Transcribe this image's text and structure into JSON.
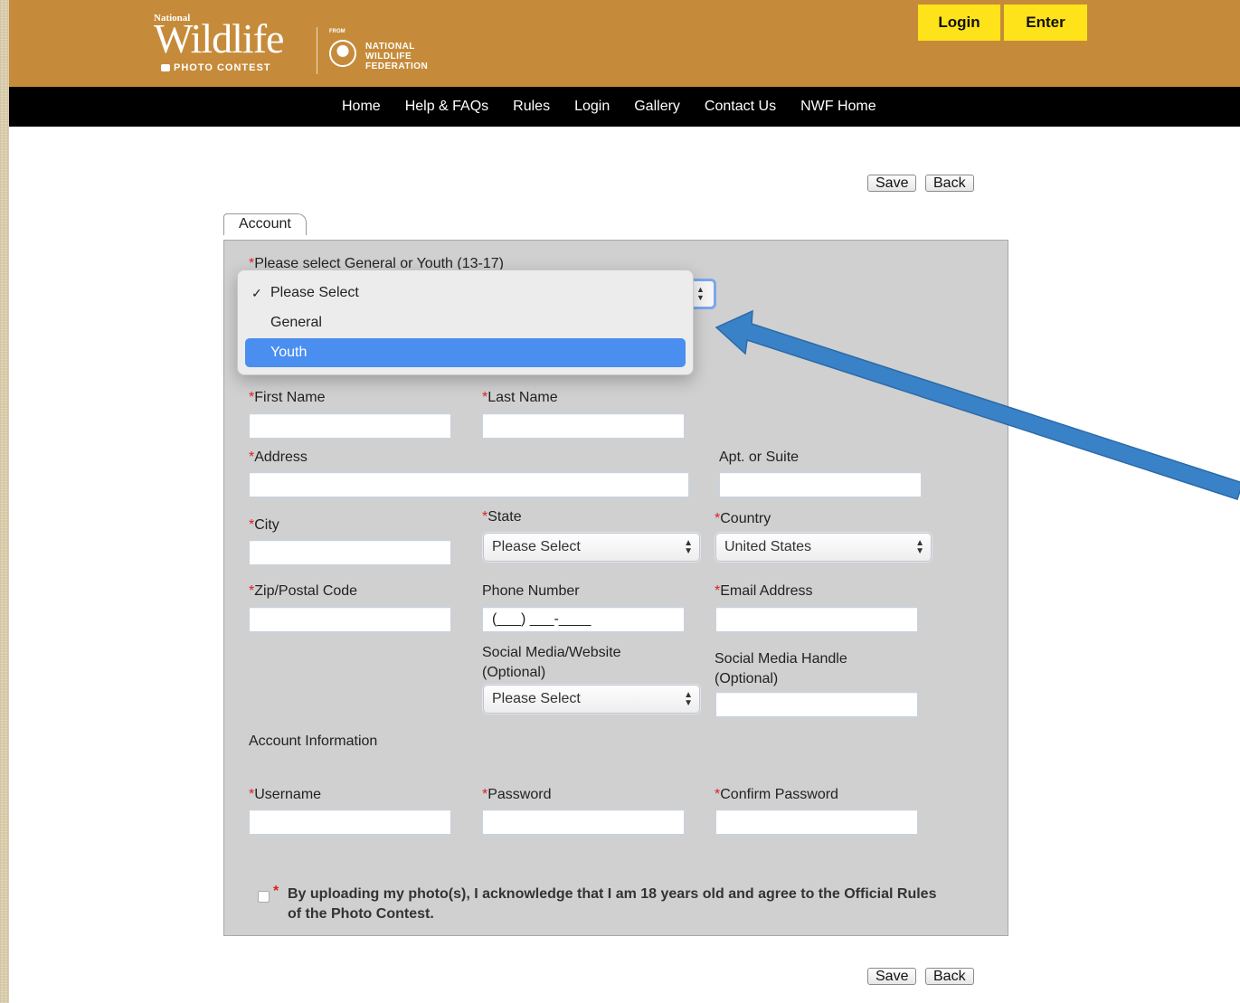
{
  "header": {
    "logo": {
      "national": "National",
      "wildlife": "Wildlife",
      "photo_contest": "PHOTO CONTEST",
      "from": "FROM",
      "nwf_line1": "NATIONAL",
      "nwf_line2": "WILDLIFE",
      "nwf_line3": "FEDERATION"
    },
    "login_label": "Login",
    "enter_label": "Enter"
  },
  "nav": {
    "items": [
      {
        "label": "Home"
      },
      {
        "label": "Help & FAQs"
      },
      {
        "label": "Rules"
      },
      {
        "label": "Login"
      },
      {
        "label": "Gallery"
      },
      {
        "label": "Contact Us"
      },
      {
        "label": "NWF Home"
      }
    ]
  },
  "actions": {
    "save_label": "Save",
    "back_label": "Back"
  },
  "tab": {
    "label": "Account"
  },
  "form": {
    "category_label": "Please select General or Youth (13-17)",
    "category_dropdown": {
      "options": [
        "Please Select",
        "General",
        "Youth"
      ],
      "checked": "Please Select",
      "highlighted": "Youth"
    },
    "first_name_label": "First Name",
    "last_name_label": "Last Name",
    "address_label": "Address",
    "apt_label": "Apt. or Suite",
    "city_label": "City",
    "state_label": "State",
    "state_value": "Please Select",
    "country_label": "Country",
    "country_value": "United States",
    "zip_label": "Zip/Postal Code",
    "phone_label": "Phone Number",
    "phone_placeholder": "(___) ___-____",
    "email_label": "Email Address",
    "social_label_line1": "Social Media/Website",
    "social_label_line2": "(Optional)",
    "social_value": "Please Select",
    "handle_label_line1": "Social Media Handle",
    "handle_label_line2": "(Optional)",
    "account_info_heading": "Account Information",
    "username_label": "Username",
    "password_label": "Password",
    "confirm_password_label": "Confirm Password",
    "required_marker": "*",
    "acknowledgement": "By uploading my photo(s), I acknowledge that I am 18 years old and agree to the Official Rules of the Photo Contest."
  },
  "colors": {
    "header_bg": "#c68b3a",
    "nav_bg": "#000000",
    "button_yellow": "#ffe31a",
    "panel_bg": "#d0d0d0",
    "required_red": "#e02020",
    "highlight_blue": "#4a8ef0",
    "arrow_blue": "#3a82c8"
  },
  "annotation": {
    "type": "arrow",
    "icon": "pointer-arrow-icon"
  }
}
